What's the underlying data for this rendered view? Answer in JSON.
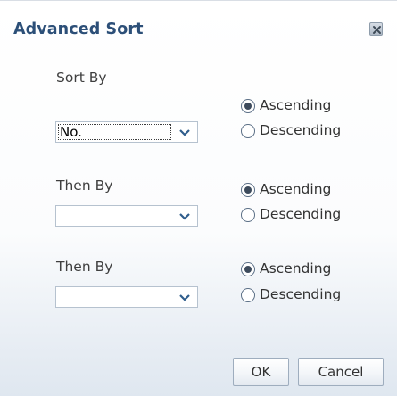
{
  "dialog": {
    "title": "Advanced Sort",
    "close_icon": "close-icon"
  },
  "criteria": [
    {
      "label": "Sort By",
      "selected": "No.",
      "ascending_label": "Ascending",
      "descending_label": "Descending",
      "ascending_checked": true
    },
    {
      "label": "Then By",
      "selected": "",
      "ascending_label": "Ascending",
      "descending_label": "Descending",
      "ascending_checked": true
    },
    {
      "label": "Then By",
      "selected": "",
      "ascending_label": "Ascending",
      "descending_label": "Descending",
      "ascending_checked": true
    }
  ],
  "buttons": {
    "ok": "OK",
    "cancel": "Cancel"
  },
  "colors": {
    "title": "#2c4f78",
    "border": "#b6c2cf"
  }
}
